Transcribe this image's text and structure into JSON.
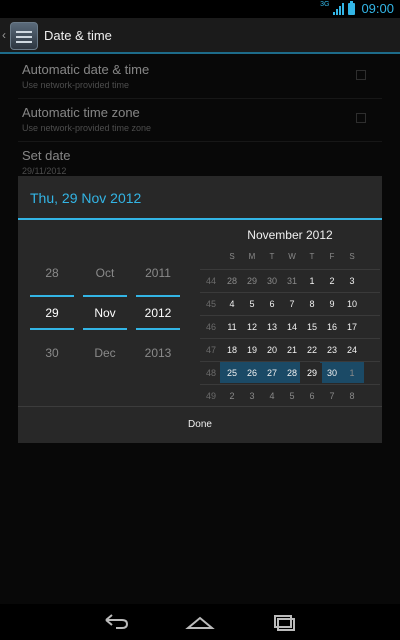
{
  "status_bar": {
    "network": "3G",
    "time": "09:00",
    "accent_color": "#33b5e5"
  },
  "action_bar": {
    "title": "Date & time",
    "up_icon": "chevron-left-icon",
    "app_icon": "settings-sliders-icon"
  },
  "settings": {
    "items": [
      {
        "title": "Automatic date & time",
        "summary": "Use network-provided time",
        "checked": false
      },
      {
        "title": "Automatic time zone",
        "summary": "Use network-provided time zone",
        "checked": false
      },
      {
        "title": "Set date",
        "summary": "29/11/2012"
      }
    ]
  },
  "dialog": {
    "title": "Thu, 29 Nov 2012",
    "spinners": {
      "day": {
        "prev": "28",
        "current": "29",
        "next": "30"
      },
      "month": {
        "prev": "Oct",
        "current": "Nov",
        "next": "Dec"
      },
      "year": {
        "prev": "2011",
        "current": "2012",
        "next": "2013"
      }
    },
    "calendar": {
      "month_label": "November 2012",
      "weekday_headers": [
        "S",
        "M",
        "T",
        "W",
        "T",
        "F",
        "S"
      ],
      "weeks": [
        {
          "week": "44",
          "days": [
            "28",
            "29",
            "30",
            "31",
            "1",
            "2",
            "3"
          ]
        },
        {
          "week": "45",
          "days": [
            "4",
            "5",
            "6",
            "7",
            "8",
            "9",
            "10"
          ]
        },
        {
          "week": "46",
          "days": [
            "11",
            "12",
            "13",
            "14",
            "15",
            "16",
            "17"
          ]
        },
        {
          "week": "47",
          "days": [
            "18",
            "19",
            "20",
            "21",
            "22",
            "23",
            "24"
          ]
        },
        {
          "week": "48",
          "days": [
            "25",
            "26",
            "27",
            "28",
            "29",
            "30",
            "1"
          ]
        },
        {
          "week": "49",
          "days": [
            "2",
            "3",
            "4",
            "5",
            "6",
            "7",
            "8"
          ]
        }
      ],
      "selected_day": "29",
      "highlight_color": "#1b4a66"
    },
    "done_label": "Done"
  },
  "nav_bar": {
    "back_icon": "back-icon",
    "home_icon": "home-icon",
    "recents_icon": "recents-icon"
  }
}
